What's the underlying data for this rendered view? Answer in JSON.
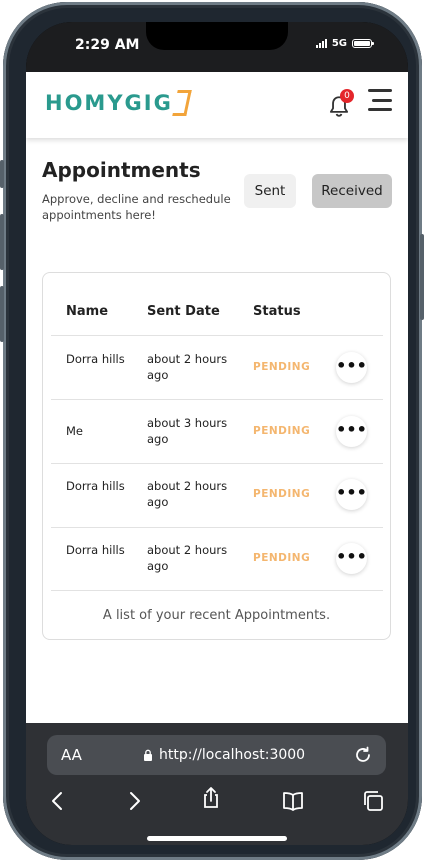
{
  "status_bar": {
    "time": "2:29 AM",
    "network": "5G"
  },
  "header": {
    "logo_text": "HOMYGIG",
    "notification_count": "0"
  },
  "page": {
    "title": "Appointments",
    "subtitle": "Approve, decline and reschedule appointments here!",
    "tabs": [
      {
        "label": "Sent",
        "active": false
      },
      {
        "label": "Received",
        "active": true
      }
    ]
  },
  "table": {
    "columns": [
      "Name",
      "Sent Date",
      "Status"
    ],
    "rows": [
      {
        "name": "Dorra hills",
        "sent_date": "about 2 hours ago",
        "status": "PENDING"
      },
      {
        "name": "Me",
        "sent_date": "about 3 hours ago",
        "status": "PENDING"
      },
      {
        "name": "Dorra hills",
        "sent_date": "about 2 hours ago",
        "status": "PENDING"
      },
      {
        "name": "Dorra hills",
        "sent_date": "about 2 hours ago",
        "status": "PENDING"
      }
    ],
    "action_label": "•••",
    "caption": "A list of your recent Appointments."
  },
  "browser": {
    "text_size_label": "AA",
    "url": "http://localhost:3000"
  },
  "colors": {
    "brand_teal": "#2a9a8e",
    "brand_orange": "#f2a43a",
    "pending": "#f4b66f",
    "badge": "#e4262b"
  }
}
